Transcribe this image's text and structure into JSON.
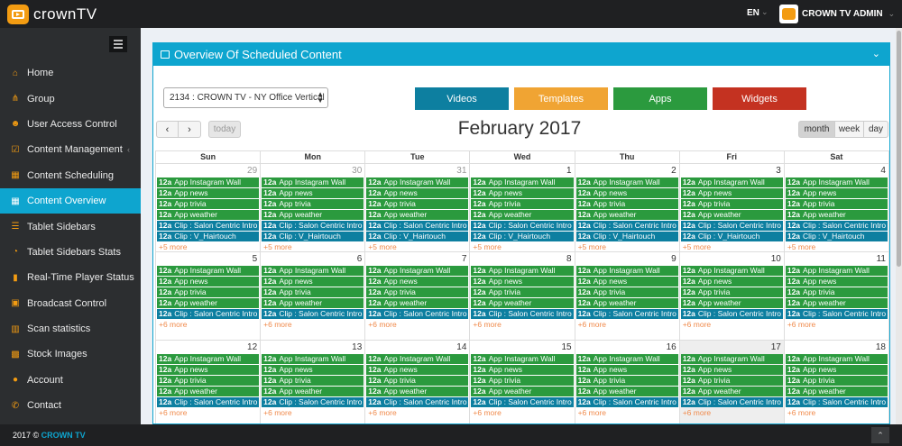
{
  "brand": {
    "name_main": "crown",
    "name_tv": "TV"
  },
  "header": {
    "language": "EN",
    "user_name": "CROWN TV ADMIN"
  },
  "sidebar": {
    "items": [
      {
        "label": "Home",
        "icon": "home-icon",
        "glyph": "⌂"
      },
      {
        "label": "Group",
        "icon": "sitemap-icon",
        "glyph": "⋔"
      },
      {
        "label": "User Access Control",
        "icon": "users-icon",
        "glyph": "☻"
      },
      {
        "label": "Content Management",
        "icon": "checkbox-icon",
        "glyph": "☑"
      },
      {
        "label": "Content Scheduling",
        "icon": "calendar-icon",
        "glyph": "▦"
      },
      {
        "label": "Content Overview",
        "icon": "calendar-icon",
        "glyph": "▦"
      },
      {
        "label": "Tablet Sidebars",
        "icon": "list-icon",
        "glyph": "☰"
      },
      {
        "label": "Tablet Sidebars Stats",
        "icon": "pie-chart-icon",
        "glyph": "◔"
      },
      {
        "label": "Real-Time Player Status",
        "icon": "signal-icon",
        "glyph": "▮"
      },
      {
        "label": "Broadcast Control",
        "icon": "broadcast-icon",
        "glyph": "▣"
      },
      {
        "label": "Scan statistics",
        "icon": "bar-chart-icon",
        "glyph": "▥"
      },
      {
        "label": "Stock Images",
        "icon": "image-icon",
        "glyph": "▩"
      },
      {
        "label": "Account",
        "icon": "user-icon",
        "glyph": "●"
      },
      {
        "label": "Contact",
        "icon": "phone-icon",
        "glyph": "✆"
      }
    ],
    "active_index": 5,
    "caret_index": 3
  },
  "panel": {
    "title": "Overview Of Scheduled Content",
    "display_select": "2134 : CROWN TV - NY Office Vertical",
    "buttons": {
      "videos": "Videos",
      "templates": "Templates",
      "apps": "Apps",
      "widgets": "Widgets"
    },
    "today_label": "today",
    "views": {
      "month": "month",
      "week": "week",
      "day": "day"
    }
  },
  "calendar": {
    "title": "February 2017",
    "weekdays": [
      "Sun",
      "Mon",
      "Tue",
      "Wed",
      "Thu",
      "Fri",
      "Sat"
    ],
    "weeks": [
      {
        "days": [
          {
            "num": "29",
            "other": true
          },
          {
            "num": "30",
            "other": true
          },
          {
            "num": "31",
            "other": true
          },
          {
            "num": "1"
          },
          {
            "num": "2"
          },
          {
            "num": "3"
          },
          {
            "num": "4"
          }
        ],
        "events": [
          {
            "time": "12a",
            "title": "App Instagram Wall",
            "color": "green"
          },
          {
            "time": "12a",
            "title": "App news",
            "color": "green"
          },
          {
            "time": "12a",
            "title": "App trivia",
            "color": "green"
          },
          {
            "time": "12a",
            "title": "App weather",
            "color": "green"
          },
          {
            "time": "12a",
            "title": "Clip : Salon Centric Intro",
            "color": "blue"
          },
          {
            "time": "12a",
            "title": "Clip : V_Hairtouch",
            "color": "blue"
          }
        ],
        "more": "+5 more"
      },
      {
        "days": [
          {
            "num": "5"
          },
          {
            "num": "6"
          },
          {
            "num": "7"
          },
          {
            "num": "8"
          },
          {
            "num": "9"
          },
          {
            "num": "10"
          },
          {
            "num": "11"
          }
        ],
        "events": [
          {
            "time": "12a",
            "title": "App Instagram Wall",
            "color": "green"
          },
          {
            "time": "12a",
            "title": "App news",
            "color": "green"
          },
          {
            "time": "12a",
            "title": "App trivia",
            "color": "green"
          },
          {
            "time": "12a",
            "title": "App weather",
            "color": "green"
          },
          {
            "time": "12a",
            "title": "Clip : Salon Centric Intro",
            "color": "blue"
          }
        ],
        "more": "+6 more"
      },
      {
        "days": [
          {
            "num": "12"
          },
          {
            "num": "13"
          },
          {
            "num": "14"
          },
          {
            "num": "15"
          },
          {
            "num": "16"
          },
          {
            "num": "17",
            "highlight": true
          },
          {
            "num": "18"
          }
        ],
        "events": [
          {
            "time": "12a",
            "title": "App Instagram Wall",
            "color": "green"
          },
          {
            "time": "12a",
            "title": "App news",
            "color": "green"
          },
          {
            "time": "12a",
            "title": "App trivia",
            "color": "green"
          },
          {
            "time": "12a",
            "title": "App weather",
            "color": "green"
          },
          {
            "time": "12a",
            "title": "Clip : Salon Centric Intro",
            "color": "blue"
          }
        ],
        "more": "+6 more"
      }
    ]
  },
  "footer": {
    "year": "2017 ©",
    "brand": "CROWN TV"
  },
  "colors": {
    "accent": "#0ea5cf",
    "orange": "#f39c12",
    "event_green": "#2b9a3e",
    "event_blue": "#0d7fa0",
    "widgets_red": "#c43221",
    "more_link": "#f08a4b"
  }
}
